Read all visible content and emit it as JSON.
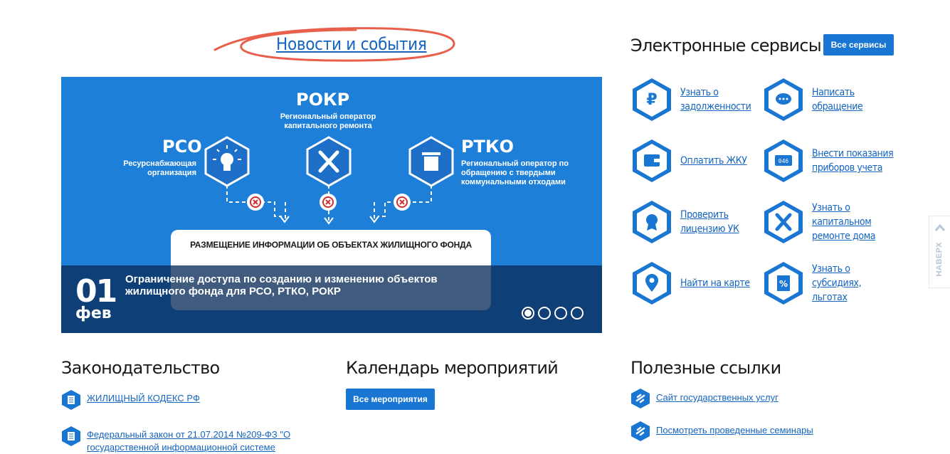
{
  "news": {
    "title": "Новости и события",
    "slide": {
      "day": "01",
      "month": "фев",
      "caption": "Ограничение доступа по созданию и изменению объектов жилищного фонда для РСО, РТКО, РОКР",
      "rokr_title": "РОКР",
      "rokr_sub": "Региональный оператор капитального ремонта",
      "rso_title": "РСО",
      "rso_sub": "Ресурснабжающая организация",
      "rtko_title": "РТКО",
      "rtko_sub": "Региональный оператор по обращению с твердыми коммунальными отходами",
      "box_title": "РАЗМЕЩЕНИЕ ИНФОРМАЦИИ ОБ ОБЪЕКТАХ ЖИЛИЩНОГО ФОНДА"
    },
    "active_slide": 1,
    "slide_count": 4
  },
  "services": {
    "title": "Электронные сервисы",
    "all_button": "Все сервисы",
    "items": [
      {
        "icon": "ruble-icon",
        "label": "Узнать о задолженности"
      },
      {
        "icon": "chat-icon",
        "label": "Написать обращение"
      },
      {
        "icon": "wallet-icon",
        "label": "Оплатить ЖКУ"
      },
      {
        "icon": "meter-icon",
        "label": "Внести показания приборов учета"
      },
      {
        "icon": "certificate-icon",
        "label": "Проверить лицензию УК"
      },
      {
        "icon": "tools-icon",
        "label": "Узнать о капитальном ремонте дома"
      },
      {
        "icon": "map-pin-icon",
        "label": "Найти на карте"
      },
      {
        "icon": "percent-ticket-icon",
        "label": "Узнать о субсидиях, льготах"
      }
    ]
  },
  "legislation": {
    "title": "Законодательство",
    "items": [
      "ЖИЛИЩНЫЙ КОДЕКС РФ",
      "Федеральный закон от 21.07.2014 №209-ФЗ \"О государственной информационной системе"
    ]
  },
  "calendar": {
    "title": "Календарь мероприятий",
    "all_button": "Все мероприятия"
  },
  "links": {
    "title": "Полезные ссылки",
    "items": [
      "Сайт государственных услуг",
      "Посмотреть проведенные семинары"
    ]
  },
  "scroll_top": {
    "label": "НАВЕРХ"
  },
  "colors": {
    "accent": "#1976d2",
    "slide_bg": "#1e7fd8",
    "highlight": "#e8604c"
  }
}
